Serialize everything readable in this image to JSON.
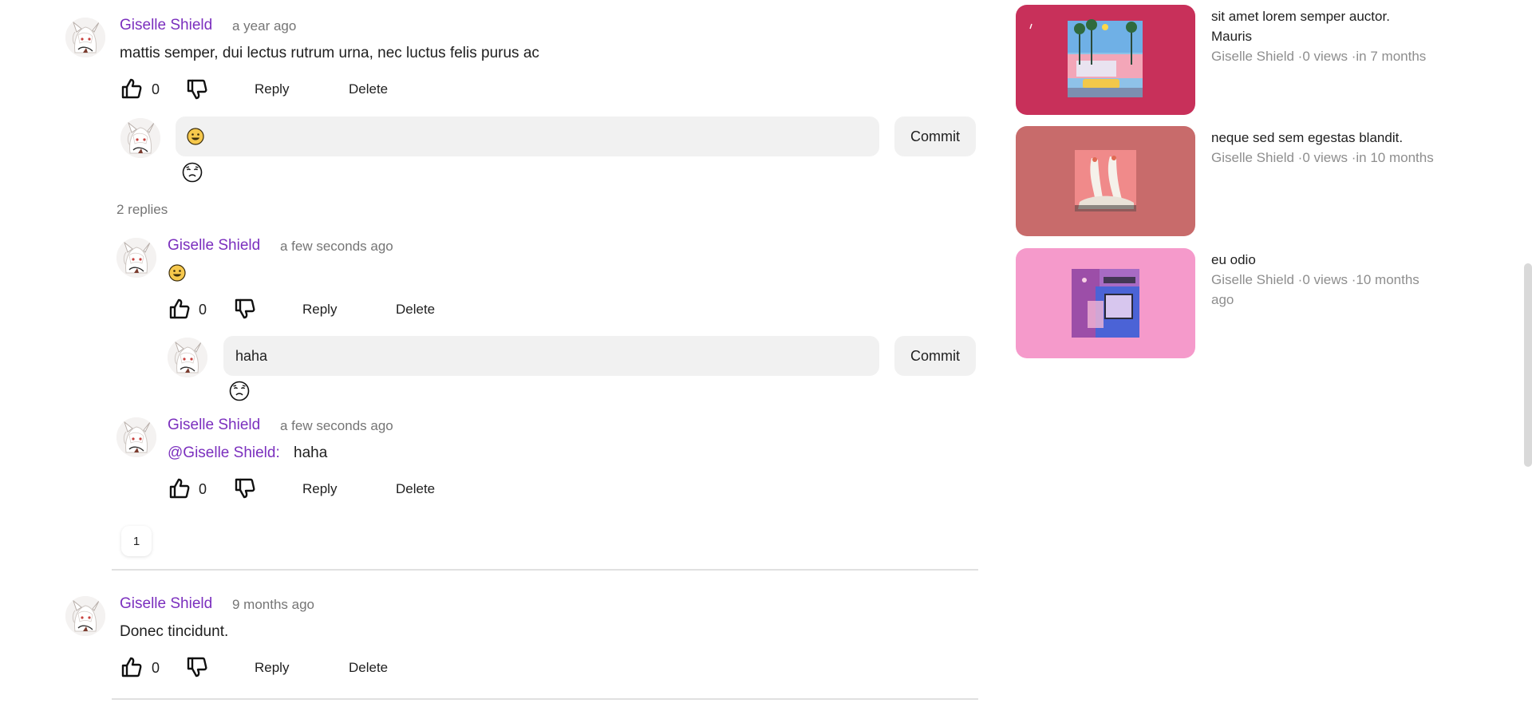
{
  "comments": [
    {
      "author": "Giselle Shield",
      "time": "a year ago",
      "text": "mattis semper, dui lectus rutrum urna, nec luctus felis purus ac",
      "likes": "0",
      "reply_label": "Reply",
      "delete_label": "Delete",
      "reply_input_value": "",
      "commit_label": "Commit",
      "replies_count_label": "2 replies",
      "replies": [
        {
          "author": "Giselle Shield",
          "time": "a few seconds ago",
          "text": "",
          "likes": "0",
          "reply_label": "Reply",
          "delete_label": "Delete",
          "reply_input_value": "haha",
          "commit_label": "Commit"
        },
        {
          "author": "Giselle Shield",
          "time": "a few seconds ago",
          "mention": "@Giselle Shield:",
          "text": "haha",
          "likes": "0",
          "reply_label": "Reply",
          "delete_label": "Delete"
        }
      ],
      "pagination": [
        "1"
      ]
    },
    {
      "author": "Giselle Shield",
      "time": "9 months ago",
      "text": "Donec tincidunt.",
      "likes": "0",
      "reply_label": "Reply",
      "delete_label": "Delete"
    }
  ],
  "recommendations": [
    {
      "title_line1": "sit amet lorem semper auctor.",
      "title_line2": "Mauris",
      "meta": "Giselle Shield ·0 views ·in 7 months",
      "bg_color": "#c8305a"
    },
    {
      "title_line1": "neque sed sem egestas blandit.",
      "meta": "Giselle Shield ·0 views ·in 10 months",
      "bg_color": "#c86b6b"
    },
    {
      "title_line1": "eu odio",
      "meta_line1": "Giselle Shield ·0 views ·10 months",
      "meta_line2": "ago",
      "bg_color": "#f59acb"
    }
  ],
  "icons": {
    "like": "thumbs-up-icon",
    "dislike": "thumbs-down-icon",
    "emoji": "smile-emoji-icon",
    "emoji_picker": "sleepy-face-icon"
  },
  "colors": {
    "author": "#7b2fbe",
    "mention": "#7b2fbe"
  }
}
